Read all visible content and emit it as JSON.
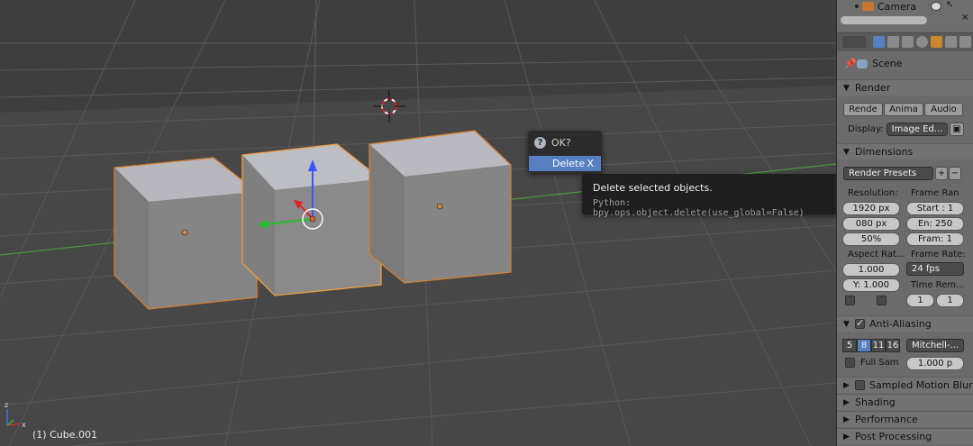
{
  "viewport": {
    "status_text": "(1) Cube.001",
    "axis_labels": {
      "x": "x",
      "z": "z"
    },
    "grid_color": "#5a5a5a",
    "floor_color": "#474747",
    "cube_color": "#858585",
    "selection_outline": "#d5802f"
  },
  "popup": {
    "title": "OK?",
    "icon": "question-icon",
    "delete_label": "Delete",
    "delete_shortcut": "X"
  },
  "tooltip": {
    "description": "Delete selected objects.",
    "python": "Python: bpy.ops.object.delete(use_global=False)"
  },
  "outliner": {
    "camera_label": "Camera"
  },
  "properties": {
    "scene_label": "Scene",
    "render": {
      "header": "Render",
      "buttons": [
        "Rende",
        "Anima",
        "Audio"
      ],
      "display_label": "Display:",
      "display_value": "Image Ed..."
    },
    "dimensions": {
      "header": "Dimensions",
      "presets": "Render Presets",
      "resolution_label": "Resolution:",
      "res_x": "1920 px",
      "res_y": "080 px",
      "res_pct": "50%",
      "frame_range_label": "Frame Ran",
      "start": "Start : 1",
      "end": "En: 250",
      "frame": "Fram: 1",
      "aspect_label": "Aspect Rat...",
      "aspect_x": "1.000",
      "aspect_y": "Y: 1.000",
      "frame_rate_label": "Frame Rate:",
      "fps": "24 fps",
      "time_remap_label": "Time Rem...",
      "time_old": "1",
      "time_new": "1"
    },
    "anti_aliasing": {
      "header": "Anti-Aliasing",
      "samples": [
        "5",
        "8",
        "11",
        "16"
      ],
      "selected_sample": "8",
      "filter": "Mitchell-...",
      "full_sample_label": "Full Sam",
      "filter_size": "1.000 p"
    },
    "sampled_motion_blur": "Sampled Motion Blur",
    "shading": "Shading",
    "performance": "Performance",
    "post_processing": "Post Processing"
  }
}
